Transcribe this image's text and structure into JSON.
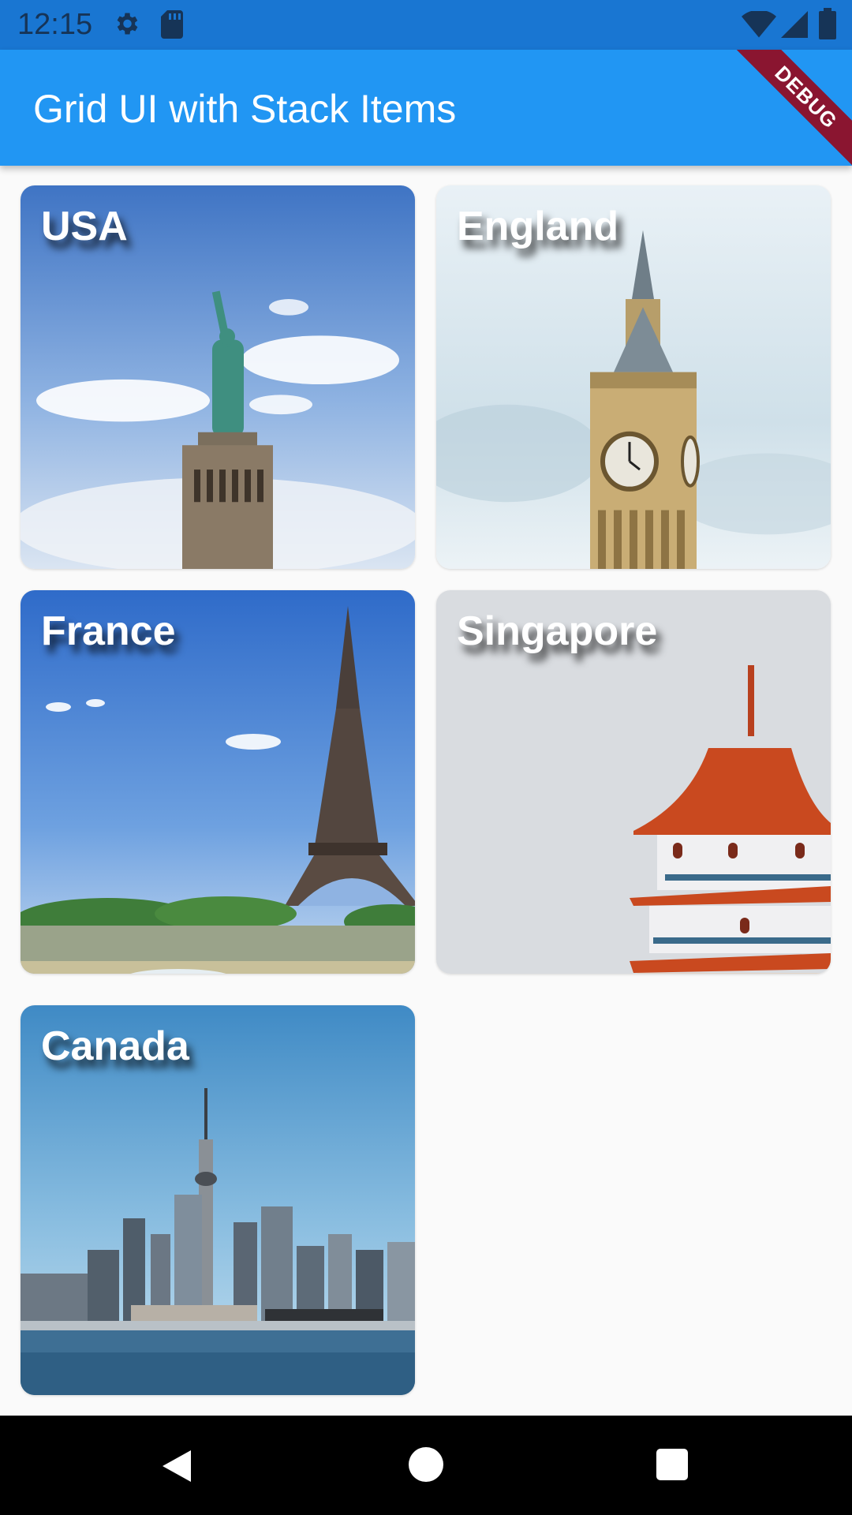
{
  "status_bar": {
    "time": "12:15",
    "icons": [
      "gear-icon",
      "sd-card-icon",
      "wifi-icon",
      "signal-icon",
      "battery-icon"
    ]
  },
  "app_bar": {
    "title": "Grid UI with Stack Items",
    "debug_banner": "DEBUG",
    "color": "#2196f3"
  },
  "grid": {
    "items": [
      {
        "label": "USA"
      },
      {
        "label": "England"
      },
      {
        "label": "France"
      },
      {
        "label": "Singapore"
      },
      {
        "label": "Canada"
      }
    ]
  },
  "nav_bar": {
    "icons": [
      "back-icon",
      "home-icon",
      "recent-apps-icon"
    ]
  }
}
